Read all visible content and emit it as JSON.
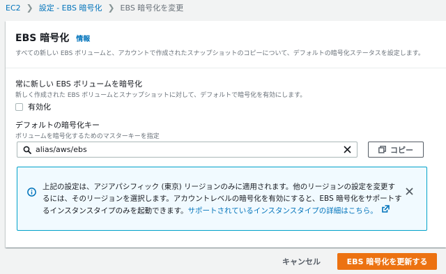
{
  "breadcrumb": {
    "items": [
      {
        "label": "EC2"
      },
      {
        "label": "設定 - EBS 暗号化"
      },
      {
        "label": "EBS 暗号化を変更"
      }
    ]
  },
  "panel": {
    "title": "EBS 暗号化",
    "info_label": "情報",
    "description": "すべての新しい EBS ボリュームと、アカウントで作成されたスナップショットのコピーについて、デフォルトの暗号化ステータスを設定します。"
  },
  "always_encrypt": {
    "label": "常に新しい EBS ボリュームを暗号化",
    "description": "新しく作成された EBS ボリュームとスナップショットに対して、デフォルトで暗号化を有効にします。",
    "checkbox_label": "有効化",
    "checked": false
  },
  "default_key": {
    "label": "デフォルトの暗号化キー",
    "description": "ボリュームを暗号化するためのマスターキーを指定",
    "value": "alias/aws/ebs",
    "copy_label": "コピー"
  },
  "alert": {
    "text": "上記の設定は、アジアパシフィック (東京) リージョンのみに適用されます。他のリージョンの設定を変更するには、そのリージョンを選択します。アカウントレベルの暗号化を有効にすると、EBS 暗号化をサポートするインスタンスタイプのみを起動できます。",
    "link_text": "サポートされているインスタンスタイプの詳細はこちら。",
    "color": "#00a1c9"
  },
  "footer": {
    "cancel_label": "キャンセル",
    "submit_label": "EBS 暗号化を更新する",
    "submit_color": "#ec7211"
  }
}
